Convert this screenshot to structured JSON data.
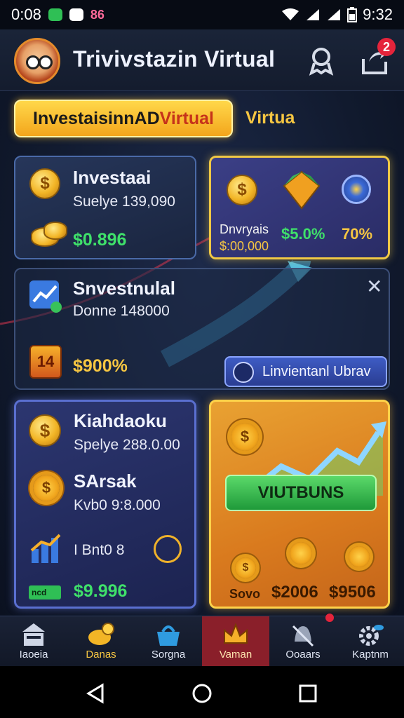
{
  "status_bar": {
    "time_left": "0:08",
    "badge_text": "86",
    "time_right": "9:32"
  },
  "header": {
    "title": "Trivivstazin Virtual",
    "notification_count": "2",
    "icons": [
      "avatar",
      "trophy-icon",
      "share-icon"
    ]
  },
  "tabs": {
    "active_label_main": "InvestaisinnAD ",
    "active_label_accent": "Virtual",
    "inactive_label": "Virtua"
  },
  "card_investai": {
    "title": "Investaai",
    "subtitle": "Suelye 139,090",
    "value": "$0.896"
  },
  "card_stats": {
    "label": "Dnvryais",
    "amount": "$:00,000",
    "percent_green": "$5.0%",
    "percent_gold": "70%"
  },
  "card_wide": {
    "title": "Snvestnulal",
    "subtitle": "Donne 148000",
    "value": "$900%",
    "button_label": "Linvientanl Ubrav"
  },
  "card_left": {
    "title1": "Kiahdaoku",
    "sub1": "Spelye 288.0.00",
    "title2": "SArsak",
    "sub2": "Kvb0 9:8.000",
    "row_label": "I Bnt0 8",
    "badge_label": "ncd",
    "value": "$9.996"
  },
  "card_right": {
    "button_label": "VIUTBUNS",
    "label_1": "Sovo",
    "label_2": "$2006",
    "label_3": "$9506"
  },
  "bottom_nav": [
    {
      "label": "Iaoeia",
      "icon": "home-icon"
    },
    {
      "label": "Danas",
      "icon": "coins-icon"
    },
    {
      "label": "Sorgna",
      "icon": "basket-icon"
    },
    {
      "label": "Vaman",
      "icon": "crown-icon",
      "active": true
    },
    {
      "label": "Ooaars",
      "icon": "bell-icon"
    },
    {
      "label": "Kaptnm",
      "icon": "gear-icon"
    }
  ],
  "colors": {
    "accent_gold": "#f6c642",
    "accent_green": "#3fe06a",
    "active_nav": "#8a1f2a"
  }
}
